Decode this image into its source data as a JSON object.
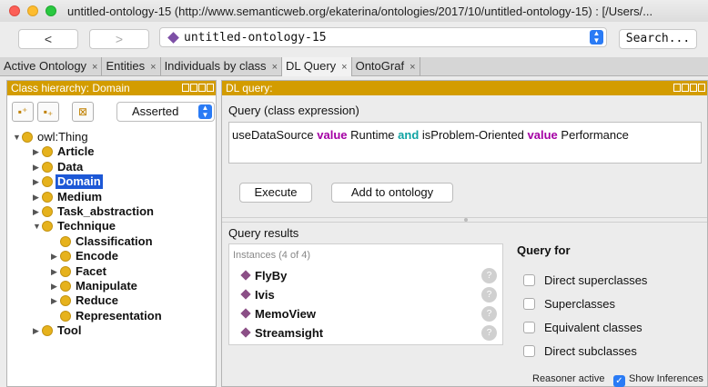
{
  "window": {
    "title": "untitled-ontology-15 (http://www.semanticweb.org/ekaterina/ontologies/2017/10/untitled-ontology-15) : [/Users/..."
  },
  "nav": {
    "back": "<",
    "forward": ">",
    "address": "untitled-ontology-15",
    "search": "Search..."
  },
  "tabs": [
    {
      "label": "Active Ontology",
      "close": "×"
    },
    {
      "label": "Entities",
      "close": "×"
    },
    {
      "label": "Individuals by class",
      "close": "×"
    },
    {
      "label": "DL Query",
      "close": "×"
    },
    {
      "label": "OntoGraf",
      "close": "×"
    }
  ],
  "class_hierarchy": {
    "header": "Class hierarchy: Domain",
    "mode": "Asserted",
    "tree": [
      {
        "label": "owl:Thing",
        "level": 0,
        "arrow": "▼"
      },
      {
        "label": "Article",
        "level": 1,
        "arrow": "▶"
      },
      {
        "label": "Data",
        "level": 1,
        "arrow": "▶"
      },
      {
        "label": "Domain",
        "level": 1,
        "arrow": "▶"
      },
      {
        "label": "Medium",
        "level": 1,
        "arrow": "▶"
      },
      {
        "label": "Task_abstraction",
        "level": 1,
        "arrow": "▶"
      },
      {
        "label": "Technique",
        "level": 1,
        "arrow": "▼"
      },
      {
        "label": "Classification",
        "level": 2,
        "arrow": ""
      },
      {
        "label": "Encode",
        "level": 2,
        "arrow": "▶"
      },
      {
        "label": "Facet",
        "level": 2,
        "arrow": "▶"
      },
      {
        "label": "Manipulate",
        "level": 2,
        "arrow": "▶"
      },
      {
        "label": "Reduce",
        "level": 2,
        "arrow": "▶"
      },
      {
        "label": "Representation",
        "level": 2,
        "arrow": ""
      },
      {
        "label": "Tool",
        "level": 1,
        "arrow": "▶"
      }
    ]
  },
  "dl_query": {
    "header": "DL query:",
    "query_label": "Query (class expression)",
    "query": {
      "p1": "useDataSource",
      "k1": "value",
      "p2": "Runtime",
      "k2": "and",
      "p3": "isProblem-Oriented",
      "k3": "value",
      "p4": "Performance"
    },
    "execute": "Execute",
    "add": "Add to ontology",
    "results_label": "Query results",
    "instances_header": "Instances (4 of 4)",
    "instances": [
      "FlyBy",
      "Ivis",
      "MemoView",
      "Streamsight"
    ],
    "help": "?",
    "query_for": "Query for",
    "options": [
      "Direct superclasses",
      "Superclasses",
      "Equivalent classes",
      "Direct subclasses"
    ],
    "reasoner": "Reasoner active",
    "show_inferences": "Show Inferences",
    "check": "✓"
  }
}
